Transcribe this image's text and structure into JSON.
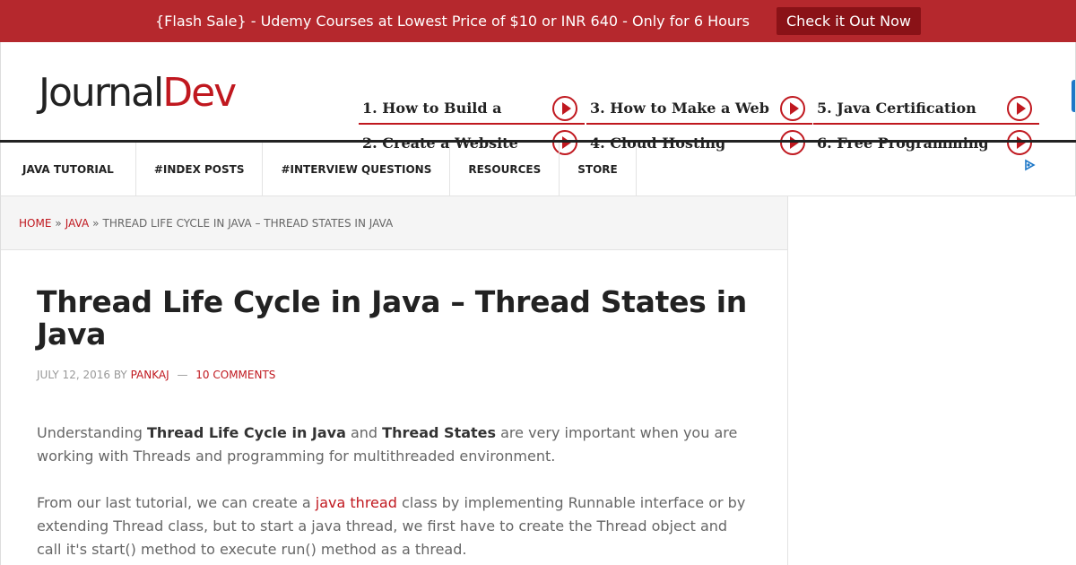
{
  "flash": {
    "text": "{Flash Sale} - Udemy Courses at Lowest Price of $10 or INR 640 - Only for 6 Hours",
    "button": "Check it Out Now",
    "bg_color": "#b5282d"
  },
  "logo": {
    "part1": "Journal",
    "part2": "Dev"
  },
  "ads": [
    {
      "label": "1. How to Build a",
      "icon": "play-circle-icon"
    },
    {
      "label": "2. Create a Website",
      "icon": "play-circle-icon"
    },
    {
      "label": "3. How to Make a Web",
      "icon": "play-circle-icon"
    },
    {
      "label": "4. Cloud Hosting",
      "icon": "play-circle-icon"
    },
    {
      "label": "5. Java Certification",
      "icon": "play-circle-icon"
    },
    {
      "label": "6. Free Programming",
      "icon": "play-circle-icon"
    }
  ],
  "nav": [
    "JAVA TUTORIAL",
    "#INDEX POSTS",
    "#INTERVIEW QUESTIONS",
    "RESOURCES",
    "STORE"
  ],
  "breadcrumb": {
    "home": "HOME",
    "sep": "»",
    "java": "JAVA",
    "current": "THREAD LIFE CYCLE IN JAVA – THREAD STATES IN JAVA"
  },
  "article": {
    "title": "Thread Life Cycle in Java – Thread States in Java",
    "date": "JULY 12, 2016",
    "by": "BY",
    "author": "PANKAJ",
    "dash": "—",
    "comments": "10 COMMENTS",
    "p1": {
      "a": "Understanding ",
      "b1": "Thread Life Cycle in Java",
      "c": " and ",
      "b2": "Thread States",
      "d": " are very important when you are working with Threads and programming for multithreaded environment."
    },
    "p2": {
      "a": "From our last tutorial, we can create a ",
      "link": "java thread",
      "b": " class by implementing Runnable interface or by extending Thread class, but to start a java thread, we first have to create the Thread object and call it's start() method to execute run() method as a thread."
    }
  },
  "colors": {
    "accent": "#c0181f",
    "text": "#666666",
    "heading": "#222222"
  }
}
